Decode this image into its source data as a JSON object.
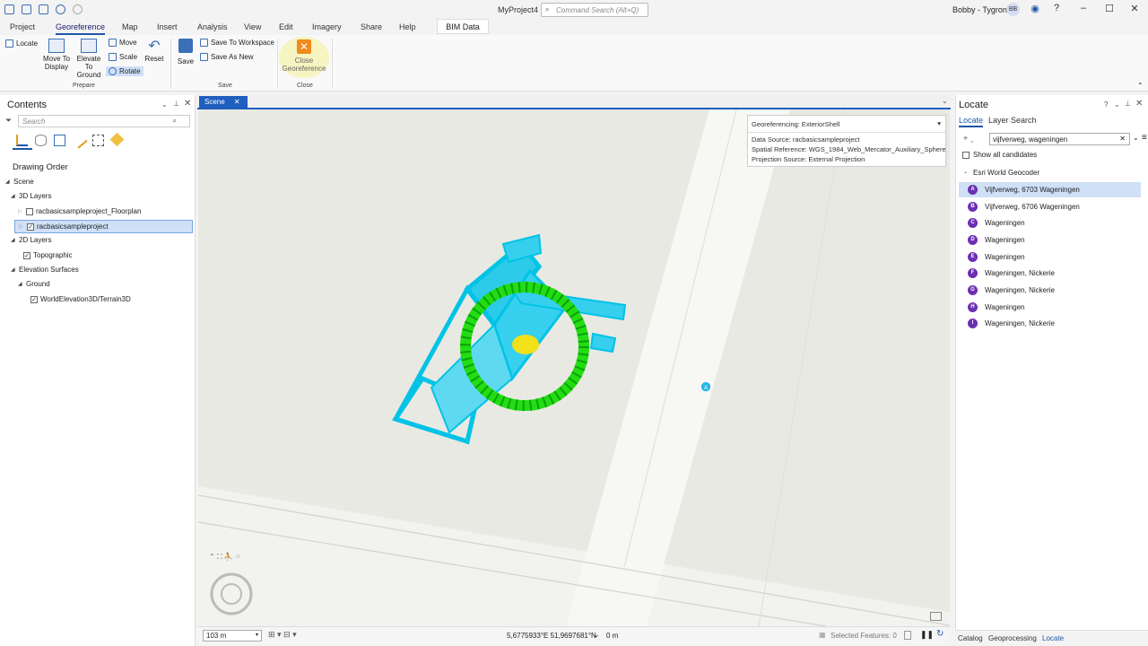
{
  "window": {
    "title": "MyProject4",
    "command_search_placeholder": "Command Search (Alt+Q)",
    "user": "Bobby - Tygron",
    "user_initials": "BB"
  },
  "ribbon_tabs": [
    "Project",
    "Georeference",
    "Map",
    "Insert",
    "Analysis",
    "View",
    "Edit",
    "Imagery",
    "Share",
    "Help"
  ],
  "contextual_tab": "BIM Data",
  "ribbon": {
    "locate": "Locate",
    "move_to_display": "Move To Display",
    "elevate_to_ground": "Elevate To Ground",
    "move": "Move",
    "scale": "Scale",
    "rotate": "Rotate",
    "reset": "Reset",
    "prepare_group": "Prepare",
    "save": "Save",
    "save_to_workspace": "Save To Workspace",
    "save_as_new": "Save As New",
    "save_group": "Save",
    "close_georeference": "Close Georeference",
    "close_group": "Close"
  },
  "contents": {
    "title": "Contents",
    "search_placeholder": "Search",
    "drawing_order": "Drawing Order",
    "tree": [
      {
        "label": "Scene",
        "level": 0,
        "checkbox": false,
        "checked": false
      },
      {
        "label": "3D Layers",
        "level": 1,
        "checkbox": false,
        "checked": false
      },
      {
        "label": "racbasicsampleproject_Floorplan",
        "level": 2,
        "checkbox": true,
        "checked": false
      },
      {
        "label": "racbasicsampleproject",
        "level": 2,
        "checkbox": true,
        "checked": true,
        "selected": true
      },
      {
        "label": "2D Layers",
        "level": 1,
        "checkbox": false,
        "checked": false
      },
      {
        "label": "Topographic",
        "level": 2,
        "checkbox": true,
        "checked": true
      },
      {
        "label": "Elevation Surfaces",
        "level": 1,
        "checkbox": false,
        "checked": false
      },
      {
        "label": "Ground",
        "level": 2,
        "checkbox": false,
        "checked": false
      },
      {
        "label": "WorldElevation3D/Terrain3D",
        "level": 3,
        "checkbox": true,
        "checked": true
      }
    ]
  },
  "scene": {
    "tab_label": "Scene",
    "georef_header": "Georeferencing: ExteriorShell",
    "georef_lines": [
      "Data Source: racbasicsampleproject",
      "Spatial Reference: WGS_1984_Web_Mercator_Auxiliary_Sphere",
      "Projection Source: External Projection"
    ],
    "marker_label": "A",
    "scale": "103 m",
    "coordinates": "5,6775933°E 51,9697681°N",
    "elevation": "0 m",
    "selected_features": "Selected Features: 0"
  },
  "locate": {
    "title": "Locate",
    "tab_locate": "Locate",
    "tab_layer_search": "Layer Search",
    "query": "vijfverweg, wageningen",
    "show_all": "Show all candidates",
    "geocoder": "Esri World Geocoder",
    "candidates": [
      {
        "badge": "A",
        "label": "Vijfverweg, 6703 Wageningen",
        "selected": true
      },
      {
        "badge": "B",
        "label": "Vijfverweg, 6706 Wageningen"
      },
      {
        "badge": "C",
        "label": "Wageningen"
      },
      {
        "badge": "D",
        "label": "Wageningen"
      },
      {
        "badge": "E",
        "label": "Wageningen"
      },
      {
        "badge": "F",
        "label": "Wageningen, Nickerie"
      },
      {
        "badge": "G",
        "label": "Wageningen, Nickerie"
      },
      {
        "badge": "H",
        "label": "Wageningen"
      },
      {
        "badge": "I",
        "label": "Wageningen, Nickerie"
      }
    ]
  },
  "bottom_tabs": [
    "Catalog",
    "Geoprocessing",
    "Locate"
  ]
}
